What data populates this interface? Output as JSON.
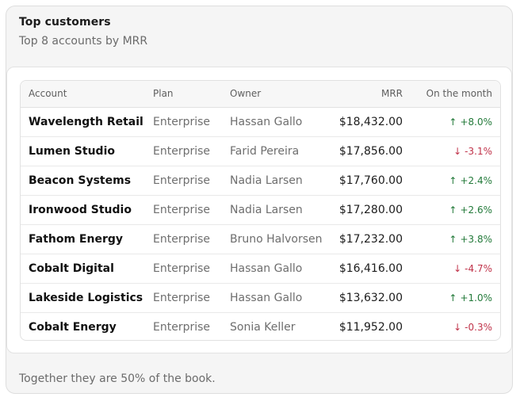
{
  "card": {
    "title": "Top customers",
    "subtitle": "Top 8 accounts by MRR",
    "footer": "Together they are 50% of the book."
  },
  "table": {
    "columns": {
      "account": "Account",
      "plan": "Plan",
      "owner": "Owner",
      "mrr": "MRR",
      "change": "On the month"
    },
    "rows": [
      {
        "account": "Wavelength Retail",
        "plan": "Enterprise",
        "owner": "Hassan Gallo",
        "mrr": "$18,432.00",
        "change": "+8.0%",
        "direction": "up"
      },
      {
        "account": "Lumen Studio",
        "plan": "Enterprise",
        "owner": "Farid Pereira",
        "mrr": "$17,856.00",
        "change": "-3.1%",
        "direction": "down"
      },
      {
        "account": "Beacon Systems",
        "plan": "Enterprise",
        "owner": "Nadia Larsen",
        "mrr": "$17,760.00",
        "change": "+2.4%",
        "direction": "up"
      },
      {
        "account": "Ironwood Studio",
        "plan": "Enterprise",
        "owner": "Nadia Larsen",
        "mrr": "$17,280.00",
        "change": "+2.6%",
        "direction": "up"
      },
      {
        "account": "Fathom Energy",
        "plan": "Enterprise",
        "owner": "Bruno Halvorsen",
        "mrr": "$17,232.00",
        "change": "+3.8%",
        "direction": "up"
      },
      {
        "account": "Cobalt Digital",
        "plan": "Enterprise",
        "owner": "Hassan Gallo",
        "mrr": "$16,416.00",
        "change": "-4.7%",
        "direction": "down"
      },
      {
        "account": "Lakeside Logistics",
        "plan": "Enterprise",
        "owner": "Hassan Gallo",
        "mrr": "$13,632.00",
        "change": "+1.0%",
        "direction": "up"
      },
      {
        "account": "Cobalt Energy",
        "plan": "Enterprise",
        "owner": "Sonia Keller",
        "mrr": "$11,952.00",
        "change": "-0.3%",
        "direction": "down"
      }
    ]
  },
  "icons": {
    "up": "arrow-up-icon",
    "down": "arrow-down-icon"
  },
  "colors": {
    "up": "#237a3a",
    "down": "#c0334a"
  }
}
